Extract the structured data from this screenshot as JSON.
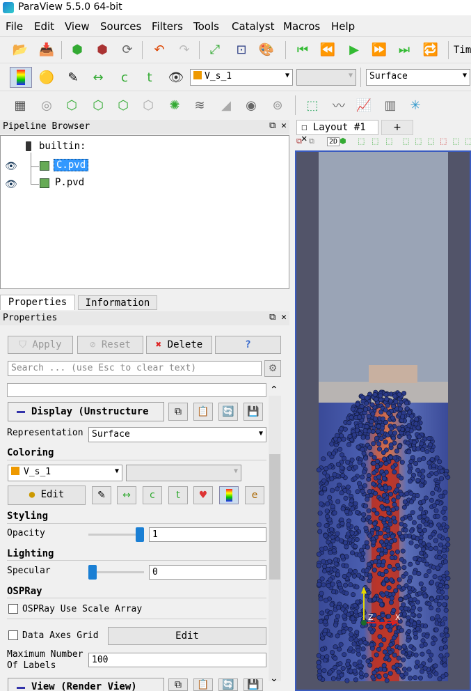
{
  "window": {
    "title": "ParaView 5.5.0 64-bit"
  },
  "menu": [
    "File",
    "Edit",
    "View",
    "Sources",
    "Filters",
    "Tools",
    "Catalyst",
    "Macros",
    "Help"
  ],
  "toolbar": {
    "time_label": "Tim",
    "array_select": "V_s_1",
    "representation_select": "Surface"
  },
  "pipeline": {
    "title": "Pipeline Browser",
    "root": "builtin:",
    "items": [
      "C.pvd",
      "P.pvd"
    ]
  },
  "view_tab": {
    "label": "Layout #1",
    "add": "+",
    "mode_2d": "2D"
  },
  "tabs": {
    "properties": "Properties",
    "information": "Information"
  },
  "properties": {
    "title": "Properties",
    "apply": "Apply",
    "reset": "Reset",
    "delete": "Delete",
    "help": "?",
    "search_placeholder": "Search ... (use Esc to clear text)",
    "display_section": "Display (Unstructure",
    "representation_label": "Representation",
    "representation_value": "Surface",
    "coloring_label": "Coloring",
    "coloring_array": "V_s_1",
    "edit_label": "Edit",
    "styling_label": "Styling",
    "opacity_label": "Opacity",
    "opacity_value": "1",
    "lighting_label": "Lighting",
    "specular_label": "Specular",
    "specular_value": "0",
    "ospray_label": "OSPRay",
    "ospray_scale_label": "OSPRay Use Scale Array",
    "data_axes_grid_label": "Data Axes Grid",
    "data_axes_edit": "Edit",
    "max_labels_label_1": "Maximum Number",
    "max_labels_label_2": "Of Labels",
    "max_labels_value": "100",
    "view_section": "View (Render View)"
  },
  "levels": {
    "opacity": 1.0,
    "specular": 0.0
  },
  "axes": {
    "z_label": "Z",
    "x_label": "X"
  }
}
